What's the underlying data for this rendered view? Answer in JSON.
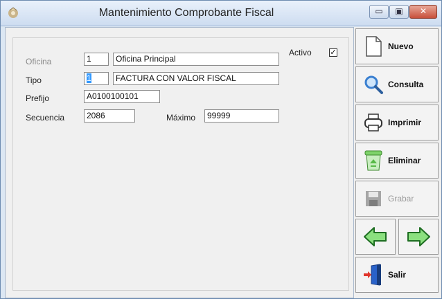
{
  "window": {
    "title": "Mantenimiento Comprobante Fiscal",
    "buttons": {
      "minimize": "▭",
      "maximize": "▣",
      "close": "✕"
    }
  },
  "form": {
    "oficina": {
      "label": "Oficina",
      "code": "1",
      "name": "Oficina Principal"
    },
    "tipo": {
      "label": "Tipo",
      "code": "1",
      "name": "FACTURA CON VALOR FISCAL"
    },
    "prefijo": {
      "label": "Prefijo",
      "value": "A0100100101"
    },
    "secuencia": {
      "label": "Secuencia",
      "value": "2086"
    },
    "maximo": {
      "label": "Máximo",
      "value": "99999"
    },
    "activo": {
      "label": "Activo",
      "checked": true,
      "mark": "✓"
    }
  },
  "toolbar": {
    "nuevo": "Nuevo",
    "consulta": "Consulta",
    "imprimir": "Imprimir",
    "eliminar": "Eliminar",
    "grabar": "Grabar",
    "salir": "Salir"
  },
  "colors": {
    "nav_arrow": "#3cb043",
    "nav_arrow_stroke": "#1e6e22",
    "search_icon": "#3a7fd0",
    "recycle_icon": "#58b947"
  }
}
